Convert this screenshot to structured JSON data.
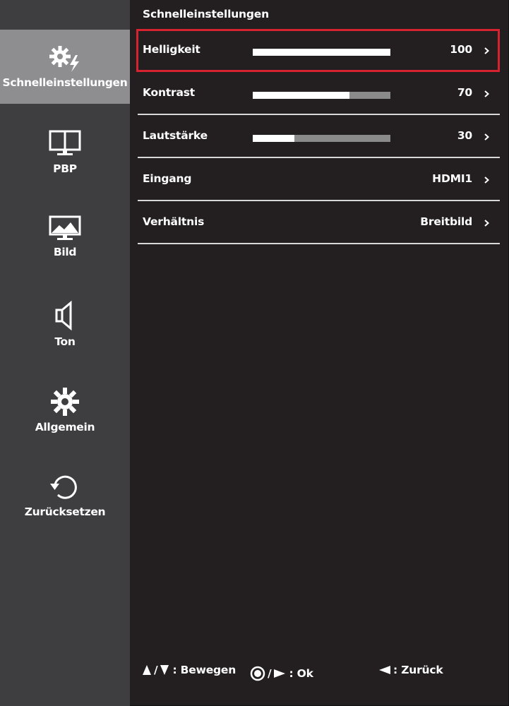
{
  "panel": {
    "title": "Schnelleinstellungen"
  },
  "sidebar": {
    "items": [
      {
        "label": "Schnelleinstellungen",
        "icon": "quick-settings-icon",
        "active": true
      },
      {
        "label": "PBP",
        "icon": "pbp-icon",
        "active": false
      },
      {
        "label": "Bild",
        "icon": "picture-icon",
        "active": false
      },
      {
        "label": "Ton",
        "icon": "speaker-icon",
        "active": false
      },
      {
        "label": "Allgemein",
        "icon": "gear-icon",
        "active": false
      },
      {
        "label": "Zurücksetzen",
        "icon": "reset-icon",
        "active": false
      }
    ]
  },
  "settings": {
    "rows": [
      {
        "label": "Helligkeit",
        "value": "100",
        "level": 1.0,
        "selected": true
      },
      {
        "label": "Kontrast",
        "value": "70",
        "level": 0.7
      },
      {
        "label": "Lautstärke",
        "value": "30",
        "level": 0.3
      },
      {
        "label": "Eingang",
        "value": "HDMI1"
      },
      {
        "label": "Verhältnis",
        "value": "Breitbild"
      }
    ]
  },
  "footer": {
    "move": {
      "separator": "/",
      "label": ": Bewegen",
      "icons": [
        "up-triangle-icon",
        "down-triangle-icon"
      ]
    },
    "ok": {
      "separator": "/",
      "label": ": Ok",
      "icons": [
        "joystick-press-icon",
        "right-triangle-icon"
      ]
    },
    "back": {
      "label": ": Zurück",
      "icons": [
        "left-triangle-icon"
      ]
    }
  },
  "colors": {
    "background": "#231f20",
    "sidebar": "#3e3e40",
    "sidebar_active": "#8e8e90",
    "highlight": "#d7232f",
    "slider_track": "#8a8a8a",
    "slider_fill": "#ffffff"
  }
}
